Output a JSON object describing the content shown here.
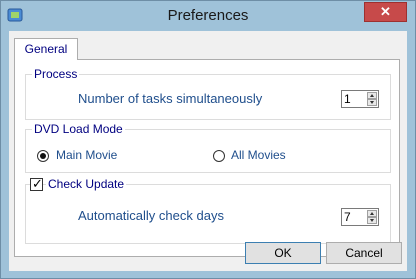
{
  "window": {
    "title": "Preferences",
    "close_label": "✕",
    "app_icon": "settings-app-icon"
  },
  "tabs": [
    {
      "label": "General",
      "active": true
    }
  ],
  "process": {
    "legend": "Process",
    "label": "Number of tasks simultaneously",
    "value": "1"
  },
  "dvd_load_mode": {
    "legend": "DVD Load Mode",
    "options": [
      {
        "label": "Main Movie",
        "selected": true
      },
      {
        "label": "All Movies",
        "selected": false
      }
    ]
  },
  "check_update": {
    "legend": "Check Update",
    "checked": true,
    "label": "Automatically check days",
    "value": "7"
  },
  "buttons": {
    "ok": "OK",
    "cancel": "Cancel"
  },
  "colors": {
    "frame": "#9fc2d9",
    "label_blue": "#1f4e8c",
    "close": "#c74a4a"
  }
}
